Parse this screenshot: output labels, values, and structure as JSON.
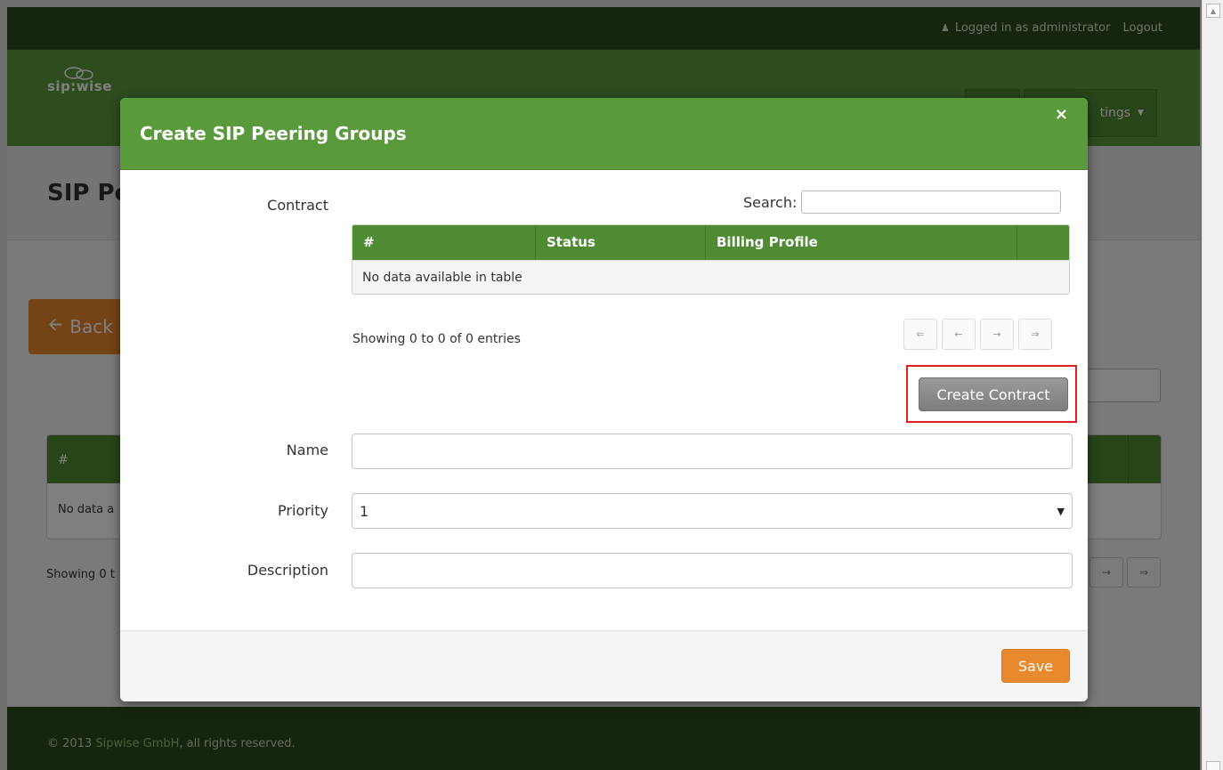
{
  "topbar": {
    "logged_in_text": "Logged in as administrator",
    "logout_label": "Logout"
  },
  "navbar": {
    "logo_text": "sip:wise",
    "settings_label": "tings"
  },
  "background": {
    "page_title": "SIP Pe",
    "back_label": "Back",
    "table_header_hash": "#",
    "table_empty_text": "No data a",
    "showing_text": "Showing 0 t",
    "pager": [
      "→",
      "⇒"
    ]
  },
  "footer": {
    "copyright_prefix": "© 2013",
    "company_link": "Sipwise GmbH",
    "copyright_suffix": ", all rights reserved."
  },
  "modal": {
    "title": "Create SIP Peering Groups",
    "close_glyph": "×",
    "contract_label": "Contract",
    "search_label": "Search:",
    "table": {
      "columns": [
        "#",
        "Status",
        "Billing Profile",
        ""
      ],
      "empty_text": "No data available in table"
    },
    "showing_text": "Showing 0 to 0 of 0 entries",
    "pager": [
      "⇐",
      "←",
      "→",
      "⇒"
    ],
    "create_contract_label": "Create Contract",
    "name_label": "Name",
    "name_value": "",
    "priority_label": "Priority",
    "priority_value": "1",
    "description_label": "Description",
    "description_value": "",
    "save_label": "Save"
  },
  "colors": {
    "brand_green": "#5b9a3c",
    "table_header_green": "#4f8b32",
    "dark_green": "#2d4a1a",
    "accent_orange": "#e8892d",
    "highlight_red": "#e02020"
  }
}
